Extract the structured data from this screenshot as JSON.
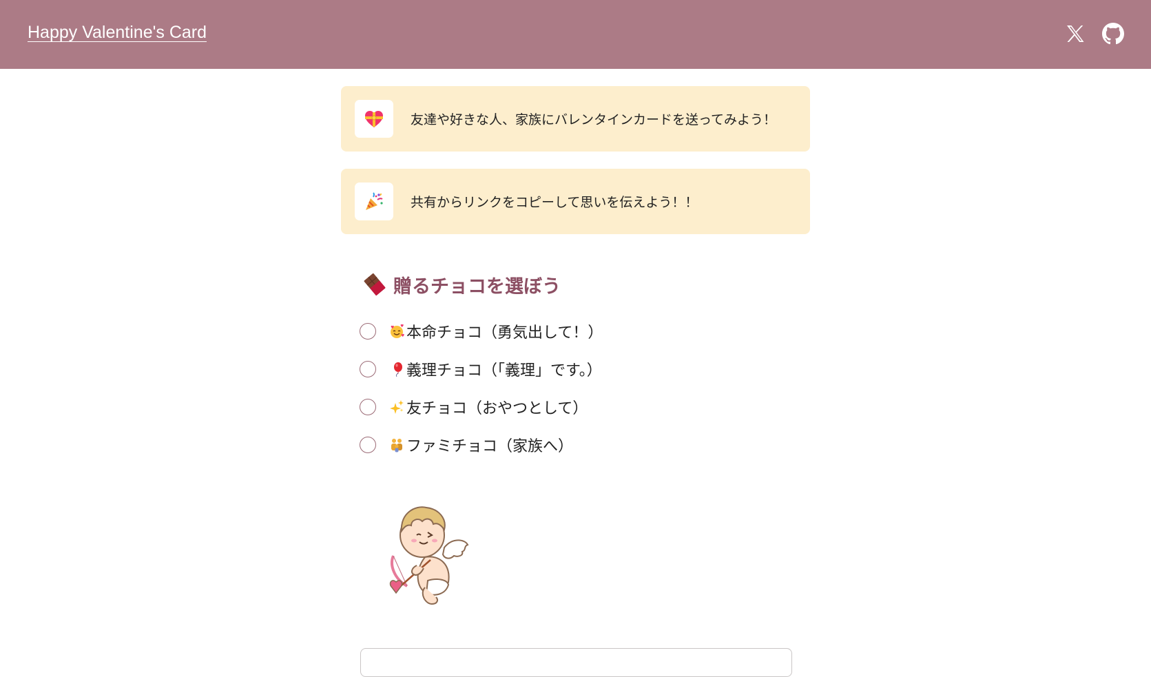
{
  "header": {
    "title": "Happy Valentine's Card",
    "background": "#ac7b86",
    "links": [
      {
        "icon": "x-logo-icon"
      },
      {
        "icon": "github-icon"
      }
    ]
  },
  "info_cards": [
    {
      "icon": "heart-with-ribbon-icon",
      "text": "友達や好きな人、家族にバレンタインカードを送ってみよう！"
    },
    {
      "icon": "party-popper-icon",
      "text": "共有からリンクをコピーして思いを伝えよう！！"
    }
  ],
  "choco_section": {
    "icon": "chocolate-bar-icon",
    "title": "贈るチョコを選ぼう",
    "options": [
      {
        "icon": "smiling-face-with-hearts-icon",
        "label": "本命チョコ（勇気出して！）",
        "selected": false
      },
      {
        "icon": "red-balloon-icon",
        "label": "義理チョコ（「義理」です。）",
        "selected": false
      },
      {
        "icon": "sparkles-icon",
        "label": "友チョコ（おやつとして）",
        "selected": false
      },
      {
        "icon": "family-icon",
        "label": "ファミチョコ（家族へ）",
        "selected": false
      }
    ]
  },
  "illustration": {
    "icon": "cupid-illustration"
  },
  "colors": {
    "accent": "#8c4f63",
    "card_background": "#fdeecd",
    "radio_border": "#9b6a75"
  }
}
